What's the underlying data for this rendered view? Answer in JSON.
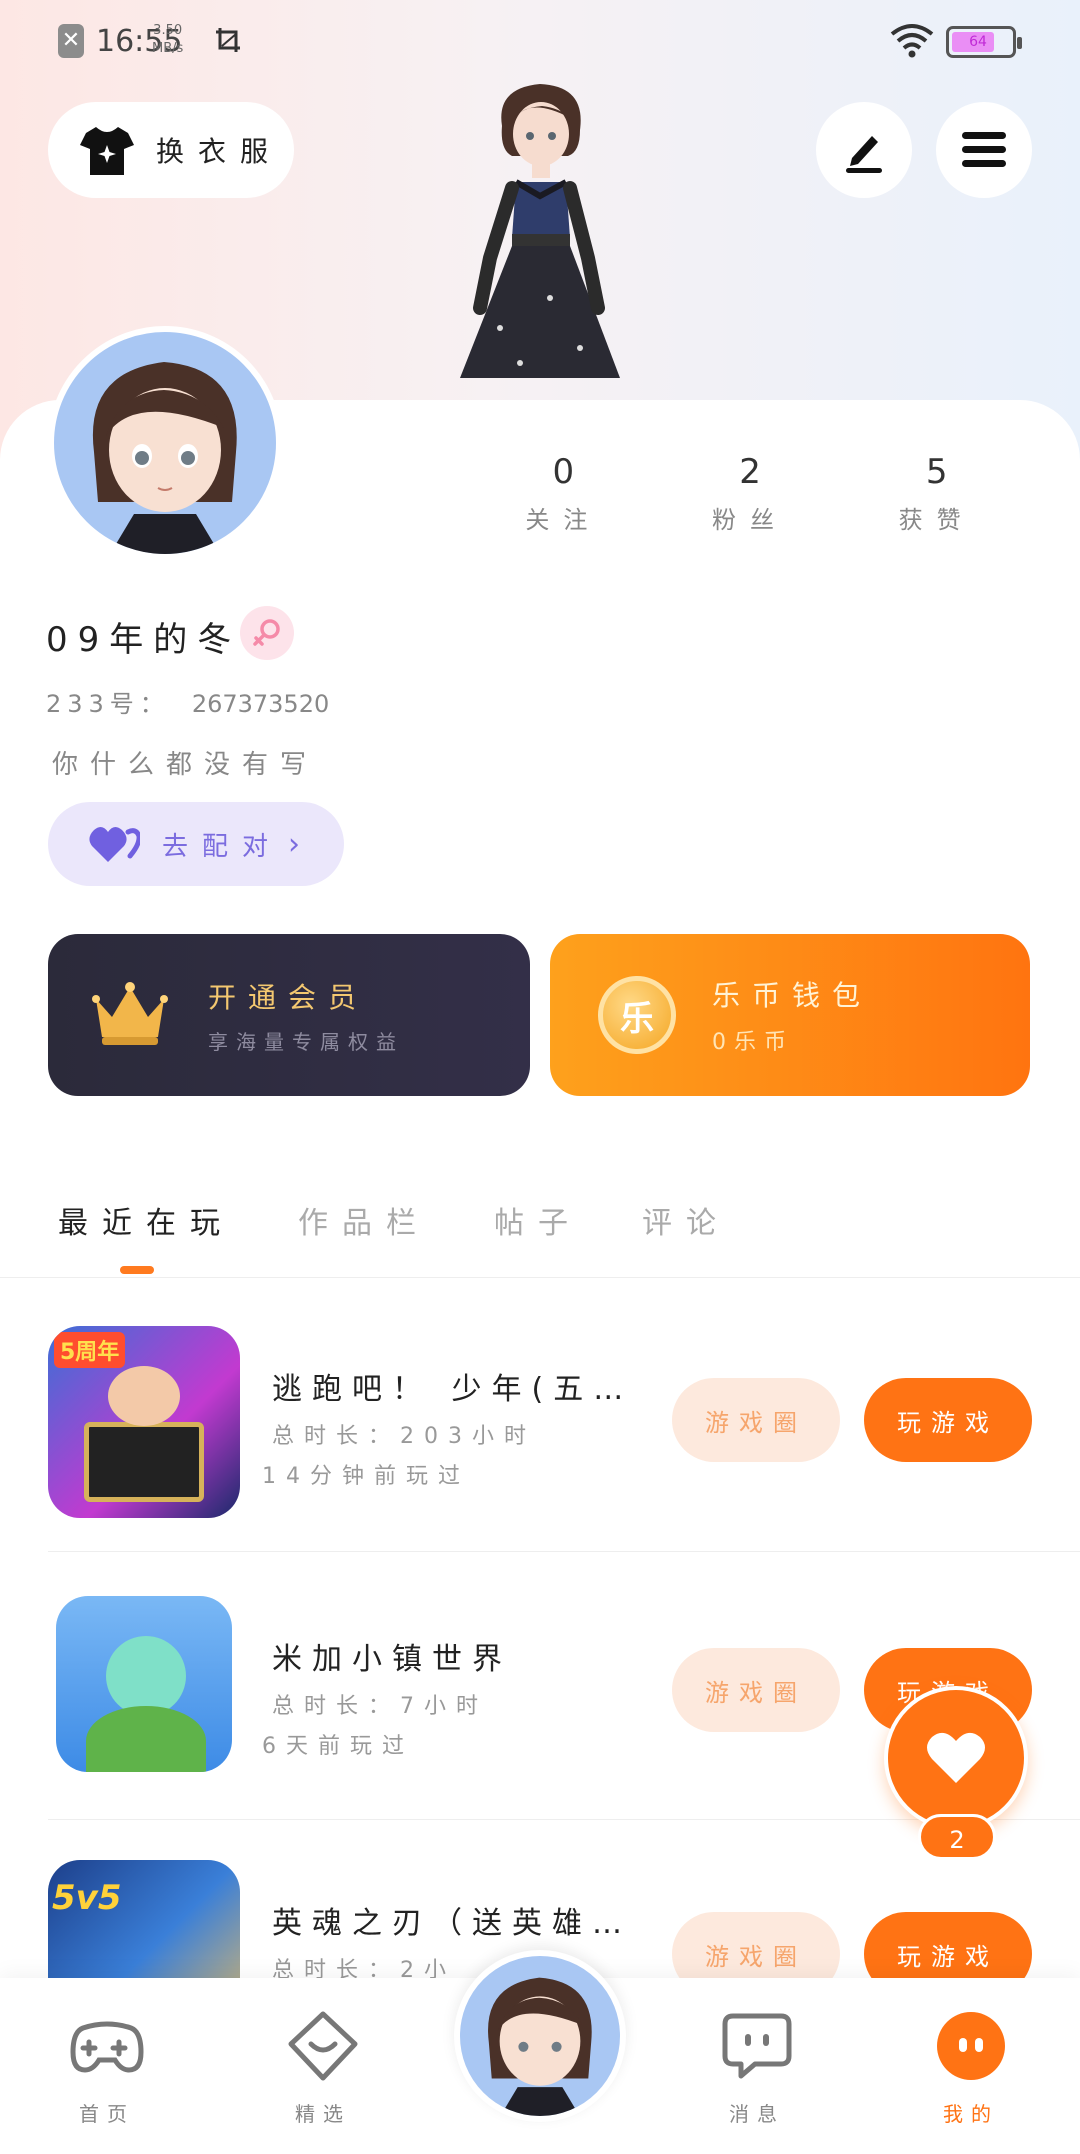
{
  "status_bar": {
    "time": "16:55",
    "speed_value": "3.50",
    "speed_unit": "MB/s",
    "battery": "64"
  },
  "top_bar": {
    "outfit_label": "换衣服"
  },
  "profile": {
    "stats": [
      {
        "value": "0",
        "label": "关注"
      },
      {
        "value": "2",
        "label": "粉丝"
      },
      {
        "value": "5",
        "label": "获赞"
      }
    ],
    "nickname": "09年的冬",
    "uid_label": "233号：",
    "uid_value": "267373520",
    "bio": "你什么都没有写",
    "match_label": "去配对"
  },
  "promos": {
    "vip_title": "开通会员",
    "vip_subtitle": "享海量专属权益",
    "wallet_title": "乐币钱包",
    "wallet_subtitle": "0乐币",
    "coin_char": "乐"
  },
  "tabs": [
    {
      "label": "最近在玩",
      "active": true
    },
    {
      "label": "作品栏",
      "active": false
    },
    {
      "label": "帖子",
      "active": false
    },
    {
      "label": "评论",
      "active": false
    }
  ],
  "games": [
    {
      "name": "逃跑吧！ 少年(五…",
      "duration": "总时长：203小时",
      "last_played": "14分钟前玩过",
      "circle_label": "游戏圈",
      "play_label": "玩游戏",
      "badge": "5周年"
    },
    {
      "name": "米加小镇世界",
      "duration": "总时长：7小时",
      "last_played": "6天前玩过",
      "circle_label": "游戏圈",
      "play_label": "玩游戏"
    },
    {
      "name": "英魂之刃（送英雄…",
      "duration": "总时长：2小",
      "last_played": "",
      "circle_label": "游戏圈",
      "play_label": "玩游戏",
      "badge": "5v5"
    }
  ],
  "floating": {
    "like_count": "2"
  },
  "bottom_nav": [
    {
      "label": "首页",
      "icon": "gamepad-icon"
    },
    {
      "label": "精选",
      "icon": "heart-diamond-icon"
    },
    {
      "label": "消息",
      "icon": "chat-bubble-icon"
    },
    {
      "label": "我的",
      "icon": "face-icon",
      "active": true
    }
  ],
  "colors": {
    "accent_orange": "#ff7314",
    "vip_gold": "#f4c870",
    "match_purple": "#7b6cdf"
  }
}
